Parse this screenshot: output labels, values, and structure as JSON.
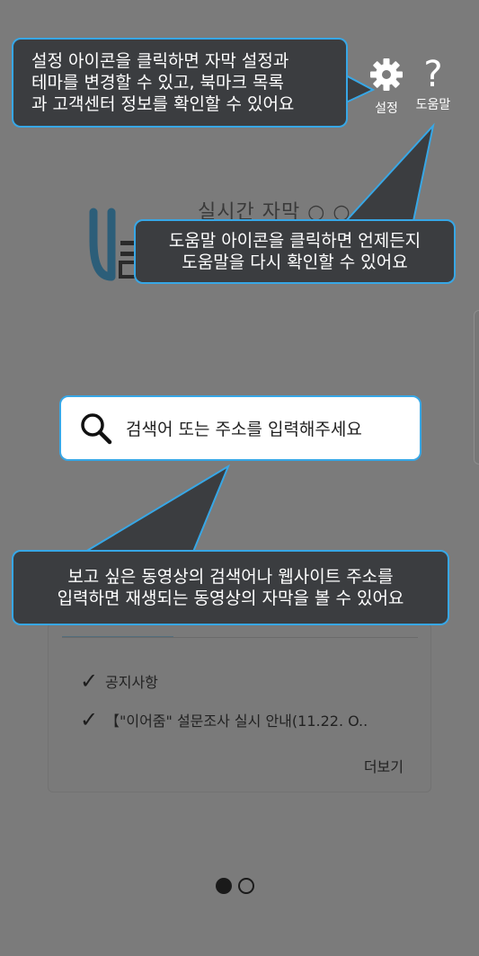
{
  "app": {
    "title": "실시간 자막 ○ ○ ○ 서"
  },
  "header": {
    "settings": {
      "label": "설정",
      "icon": "gear-icon"
    },
    "help": {
      "label": "도움말",
      "icon": "help-question-icon",
      "glyph": "?"
    }
  },
  "search": {
    "placeholder": "검색어 또는 주소를 입력해주세요",
    "icon": "search-icon"
  },
  "notices": {
    "items": [
      {
        "check": "✓",
        "text": "공지사항"
      },
      {
        "check": "✓",
        "text": "【\"이어줌\" 설문조사 실시 안내(11.22. O.."
      }
    ],
    "more_label": "더보기"
  },
  "pager": {
    "count": 2,
    "active_index": 0
  },
  "coach": {
    "settings_tip": "설정 아이콘을 클릭하면 자막 설정과\n테마를 변경할 수 있고, 북마크 목록\n과 고객센터 정보를 확인할 수 있어요",
    "help_tip": "도움말 아이콘을 클릭하면 언제든지\n도움말을 다시 확인할 수 있어요",
    "search_tip": "보고 싶은 동영상의 검색어나 웹사이트 주소를\n입력하면 재생되는 동영상의 자막을 볼 수 있어요"
  },
  "colors": {
    "overlay": "#7b7b7b",
    "tip_background": "#3b3d40",
    "tip_border": "#37a7e6",
    "logo_accent": "#2c5e79"
  }
}
